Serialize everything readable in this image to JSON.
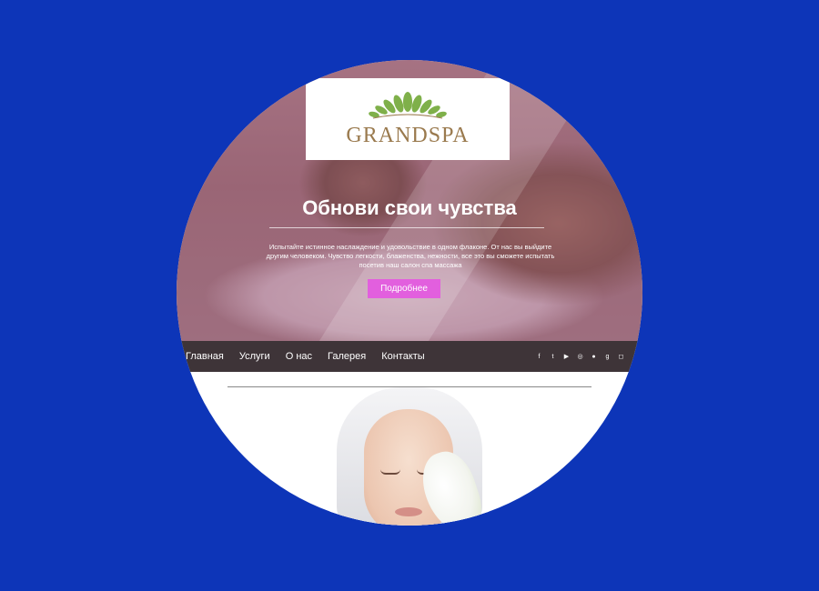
{
  "brand": {
    "name": "GRANDSPA",
    "leaf_color": "#7fb04a",
    "text_color": "#9a7a4e"
  },
  "hero": {
    "title": "Обнови свои чувства",
    "description": "Испытайте истинное наслаждение и удовольствие в одном флаконе. От нас вы выйдите другим человеком. Чувство легкости, блаженства, нежности, все это вы сможете испытать посетив наш салон спа массажа",
    "button_label": "Подробнее",
    "button_color": "#e25fde"
  },
  "nav": {
    "items": [
      "Главная",
      "Услуги",
      "О нас",
      "Галерея",
      "Контакты"
    ],
    "background": "#3e3438"
  },
  "social": [
    {
      "name": "facebook-icon",
      "glyph": "f"
    },
    {
      "name": "twitter-icon",
      "glyph": "t"
    },
    {
      "name": "youtube-icon",
      "glyph": "▶"
    },
    {
      "name": "pinterest-icon",
      "glyph": "◎"
    },
    {
      "name": "flickr-icon",
      "glyph": "●"
    },
    {
      "name": "google-plus-icon",
      "glyph": "g"
    },
    {
      "name": "instagram-icon",
      "glyph": "◻"
    }
  ],
  "colors": {
    "page_background": "#0d35b8"
  }
}
